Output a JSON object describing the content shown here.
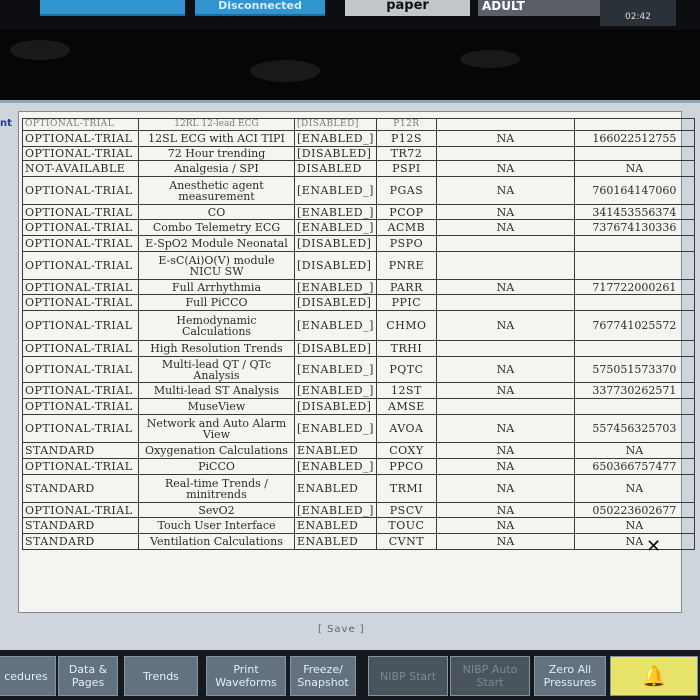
{
  "topbar": {
    "btn1_label": "",
    "btn2_label": "Disconnected",
    "paper_label": "paper",
    "adult_label": "ADULT",
    "time": "02:42"
  },
  "side_label": "nt",
  "features": [
    {
      "status": "OPTIONAL-TRIAL",
      "name": "12SL ECG with ACI TIPI",
      "flag": "[ENABLED_]",
      "code": "P12S",
      "trial": "NA",
      "key": "166022512755"
    },
    {
      "status": "OPTIONAL-TRIAL",
      "name": "72 Hour trending",
      "flag": "[DISABLED]",
      "code": "TR72",
      "trial": "",
      "key": ""
    },
    {
      "status": "NOT-AVAILABLE",
      "name": "Analgesia / SPI",
      "flag": "DISABLED",
      "code": "PSPI",
      "trial": "NA",
      "key": "NA"
    },
    {
      "status": "OPTIONAL-TRIAL",
      "name": "Anesthetic agent measurement",
      "flag": "[ENABLED_]",
      "code": "PGAS",
      "trial": "NA",
      "key": "760164147060"
    },
    {
      "status": "OPTIONAL-TRIAL",
      "name": "CO",
      "flag": "[ENABLED_]",
      "code": "PCOP",
      "trial": "NA",
      "key": "341453556374"
    },
    {
      "status": "OPTIONAL-TRIAL",
      "name": "Combo Telemetry ECG",
      "flag": "[ENABLED_]",
      "code": "ACMB",
      "trial": "NA",
      "key": "737674130336"
    },
    {
      "status": "OPTIONAL-TRIAL",
      "name": "E-SpO2 Module Neonatal",
      "flag": "[DISABLED]",
      "code": "PSPO",
      "trial": "",
      "key": ""
    },
    {
      "status": "OPTIONAL-TRIAL",
      "name": "E-sC(Ai)O(V) module NICU SW",
      "flag": "[DISABLED]",
      "code": "PNRE",
      "trial": "",
      "key": ""
    },
    {
      "status": "OPTIONAL-TRIAL",
      "name": "Full Arrhythmia",
      "flag": "[ENABLED_]",
      "code": "PARR",
      "trial": "NA",
      "key": "717722000261"
    },
    {
      "status": "OPTIONAL-TRIAL",
      "name": "Full PiCCO",
      "flag": "[DISABLED]",
      "code": "PPIC",
      "trial": "",
      "key": ""
    },
    {
      "status": "OPTIONAL-TRIAL",
      "name": "Hemodynamic Calculations",
      "flag": "[ENABLED_]",
      "code": "CHMO",
      "trial": "NA",
      "key": "767741025572"
    },
    {
      "status": "OPTIONAL-TRIAL",
      "name": "High Resolution Trends",
      "flag": "[DISABLED]",
      "code": "TRHI",
      "trial": "",
      "key": ""
    },
    {
      "status": "OPTIONAL-TRIAL",
      "name": "Multi-lead QT / QTc Analysis",
      "flag": "[ENABLED_]",
      "code": "PQTC",
      "trial": "NA",
      "key": "575051573370"
    },
    {
      "status": "OPTIONAL-TRIAL",
      "name": "Multi-lead ST Analysis",
      "flag": "[ENABLED_]",
      "code": "12ST",
      "trial": "NA",
      "key": "337730262571"
    },
    {
      "status": "OPTIONAL-TRIAL",
      "name": "MuseView",
      "flag": "[DISABLED]",
      "code": "AMSE",
      "trial": "",
      "key": ""
    },
    {
      "status": "OPTIONAL-TRIAL",
      "name": "Network and Auto Alarm View",
      "flag": "[ENABLED_]",
      "code": "AVOA",
      "trial": "NA",
      "key": "557456325703"
    },
    {
      "status": "STANDARD",
      "name": "Oxygenation Calculations",
      "flag": "ENABLED",
      "code": "COXY",
      "trial": "NA",
      "key": "NA"
    },
    {
      "status": "OPTIONAL-TRIAL",
      "name": "PiCCO",
      "flag": "[ENABLED_]",
      "code": "PPCO",
      "trial": "NA",
      "key": "650366757477"
    },
    {
      "status": "STANDARD",
      "name": "Real-time Trends / minitrends",
      "flag": "ENABLED",
      "code": "TRMI",
      "trial": "NA",
      "key": "NA"
    },
    {
      "status": "OPTIONAL-TRIAL",
      "name": "SevO2",
      "flag": "[ENABLED_]",
      "code": "PSCV",
      "trial": "NA",
      "key": "050223602677"
    },
    {
      "status": "STANDARD",
      "name": "Touch User Interface",
      "flag": "ENABLED",
      "code": "TOUC",
      "trial": "NA",
      "key": "NA"
    },
    {
      "status": "STANDARD",
      "name": "Ventilation Calculations",
      "flag": "ENABLED",
      "code": "CVNT",
      "trial": "NA",
      "key": "NA"
    }
  ],
  "cut_row": {
    "status": "OPTIONAL-TRIAL",
    "name": "12RL 12-lead ECG",
    "flag": "[DISABLED]",
    "code": "P12R"
  },
  "save_label": "[ Save ]",
  "close_glyph": "✕",
  "bottombar": [
    {
      "label": "cedures",
      "state": "normal"
    },
    {
      "label": "Data & Pages",
      "state": "normal"
    },
    {
      "label": "Trends",
      "state": "normal"
    },
    {
      "label": "Print Waveforms",
      "state": "normal"
    },
    {
      "label": "Freeze/ Snapshot",
      "state": "normal"
    },
    {
      "label": "NIBP Start",
      "state": "dim"
    },
    {
      "label": "NIBP Auto Start",
      "state": "dim"
    },
    {
      "label": "Zero All Pressures",
      "state": "normal"
    },
    {
      "label": "🔔",
      "state": "alarm"
    }
  ]
}
